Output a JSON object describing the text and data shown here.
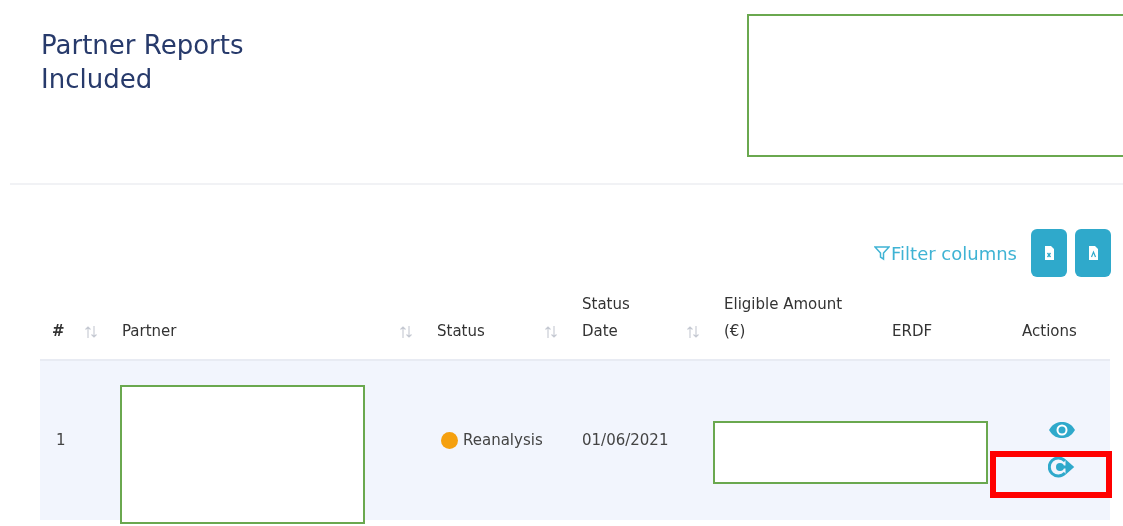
{
  "title": "Partner Reports Included",
  "toolbar": {
    "filter_label": "Filter columns",
    "exports": [
      {
        "kind": "excel"
      },
      {
        "kind": "pdf"
      }
    ]
  },
  "table": {
    "columns": [
      {
        "label": "#",
        "sortable": true
      },
      {
        "label": "Partner",
        "sortable": true
      },
      {
        "label": "Status",
        "sortable": true
      },
      {
        "label": "Status Date",
        "sortable": true
      },
      {
        "label": "Eligible Amount (€)",
        "sortable": false
      },
      {
        "label": "ERDF",
        "sortable": false
      },
      {
        "label": "Actions",
        "sortable": false
      }
    ],
    "rows": [
      {
        "number": "1",
        "status": {
          "label": "Reanalysis",
          "color": "#f5a00f"
        },
        "status_date": "01/06/2021",
        "actions": [
          {
            "kind": "view"
          },
          {
            "kind": "exit"
          }
        ]
      }
    ]
  }
}
